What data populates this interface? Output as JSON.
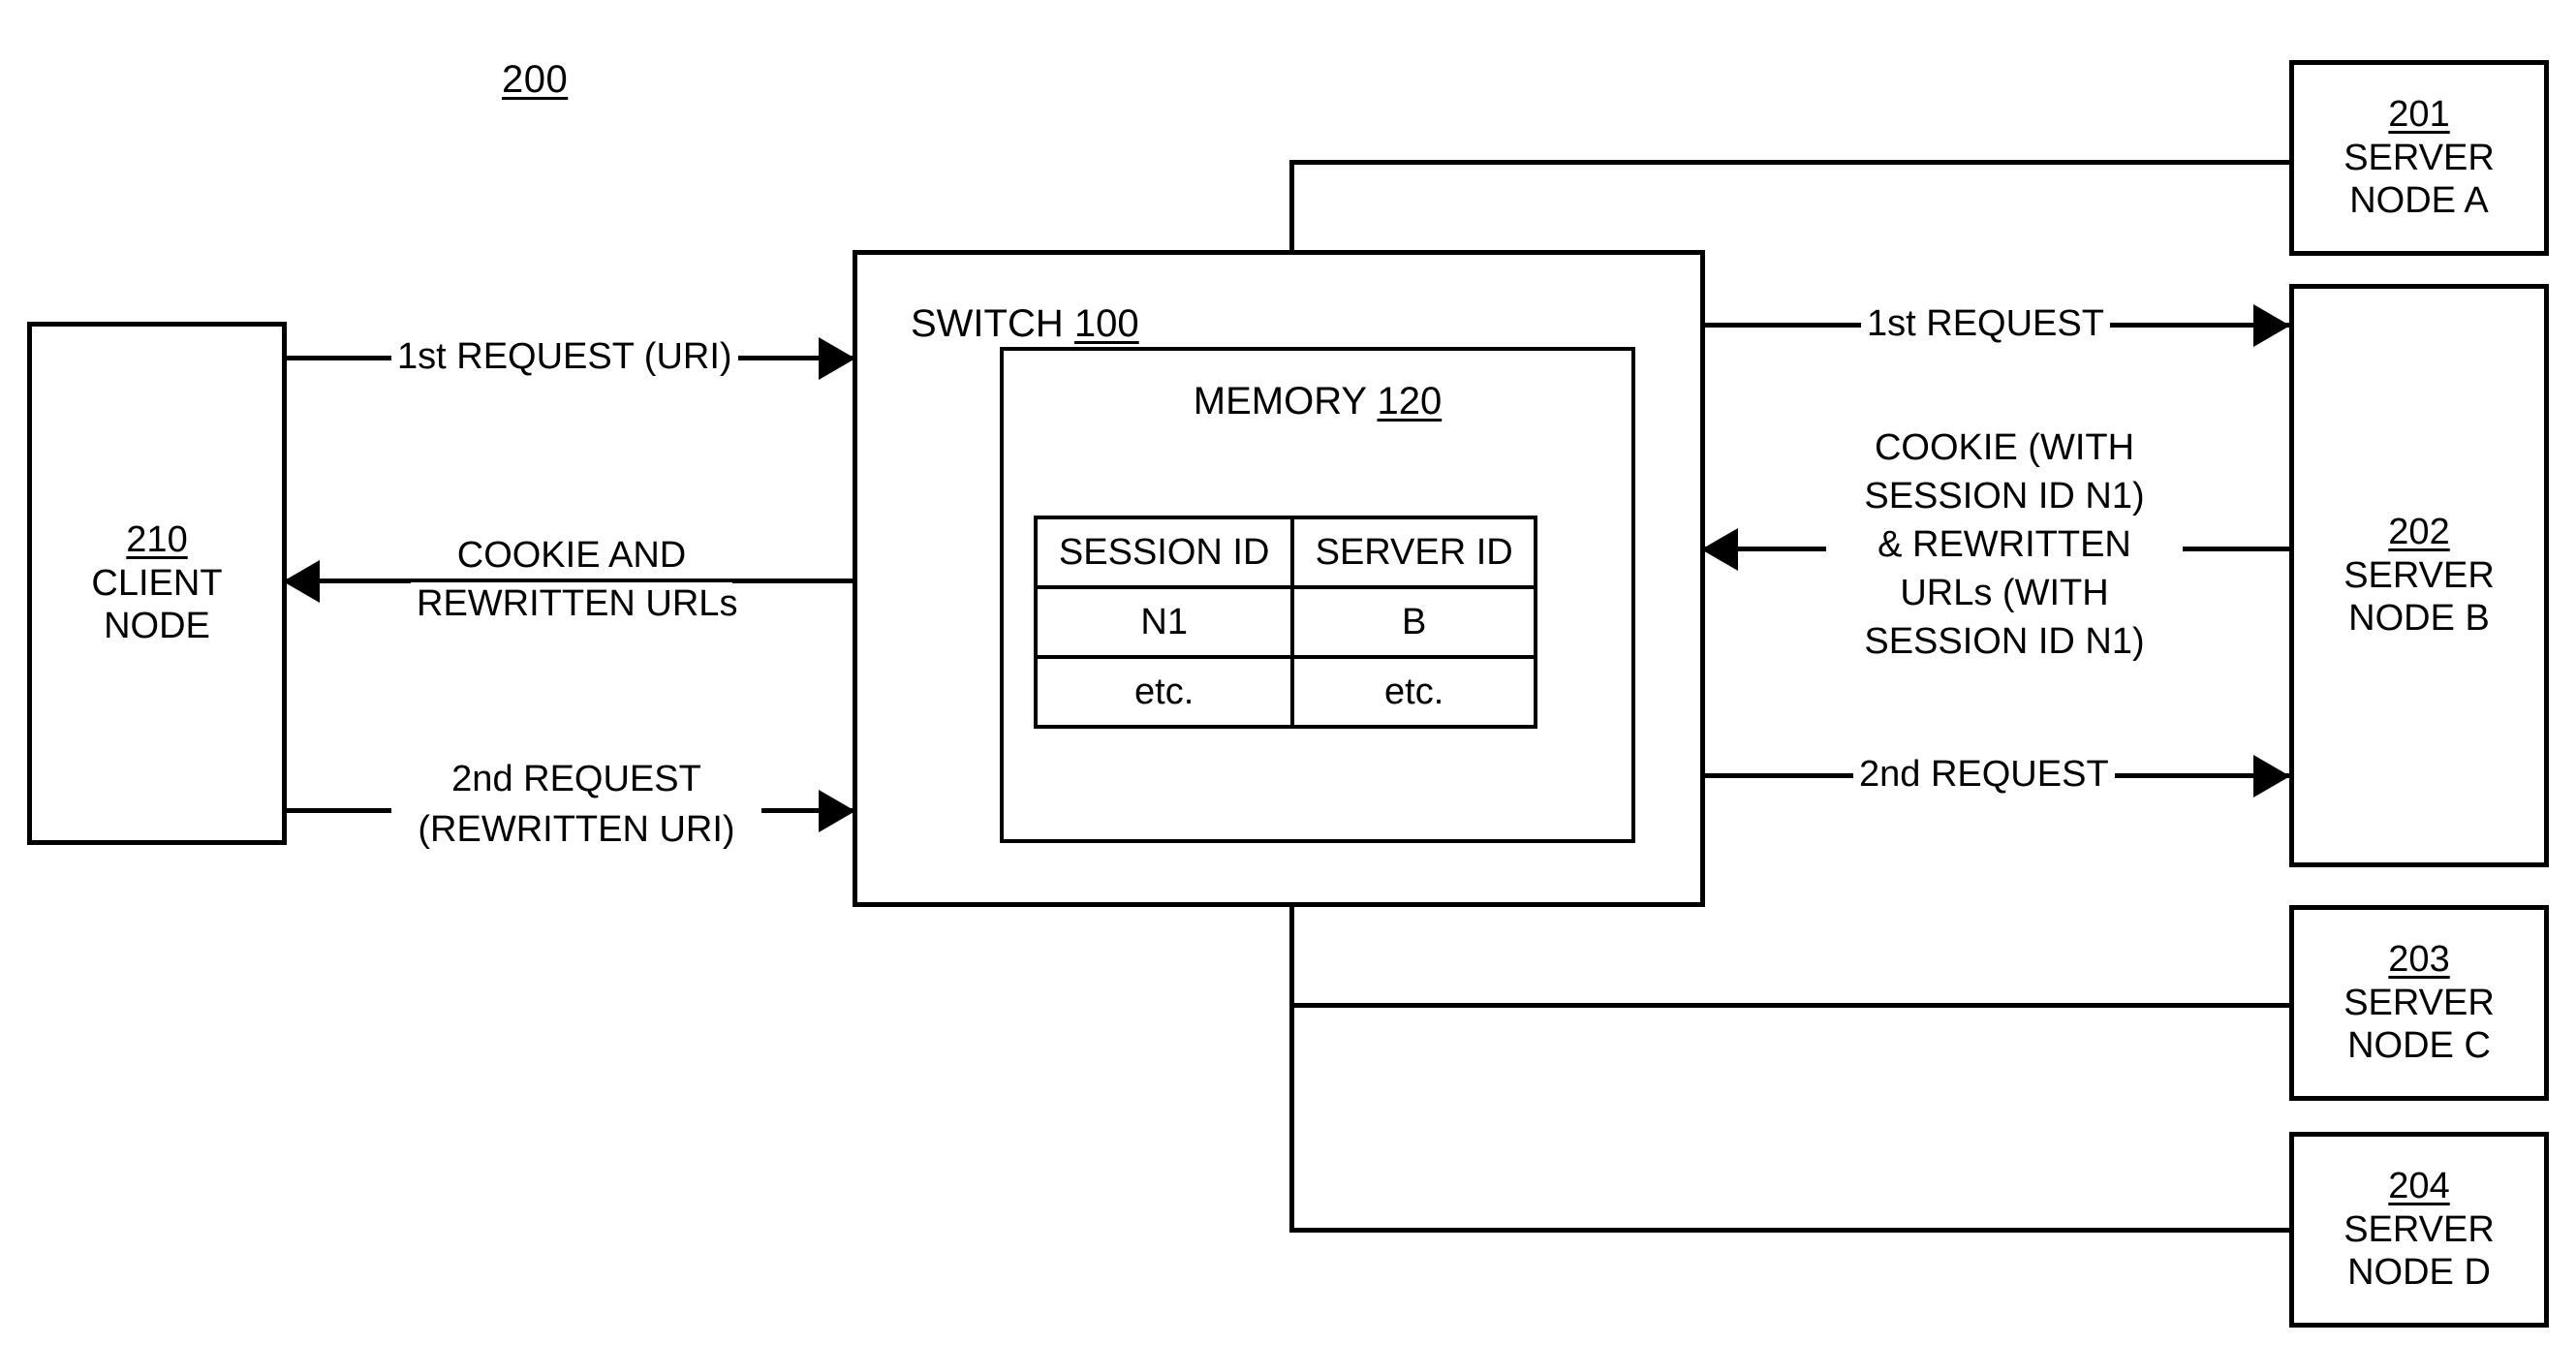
{
  "figure": {
    "number": "200"
  },
  "client": {
    "ref": "210",
    "line1": "CLIENT",
    "line2": "NODE"
  },
  "switch": {
    "label": "SWITCH",
    "ref": "100",
    "memory": {
      "label": "MEMORY",
      "ref": "120",
      "table": {
        "headers": [
          "SESSION ID",
          "SERVER ID"
        ],
        "rows": [
          [
            "N1",
            "B"
          ],
          [
            "etc.",
            "etc."
          ]
        ]
      }
    }
  },
  "servers": [
    {
      "ref": "201",
      "line1": "SERVER",
      "line2": "NODE A"
    },
    {
      "ref": "202",
      "line1": "SERVER",
      "line2": "NODE B"
    },
    {
      "ref": "203",
      "line1": "SERVER",
      "line2": "NODE C"
    },
    {
      "ref": "204",
      "line1": "SERVER",
      "line2": "NODE D"
    }
  ],
  "edges": {
    "client_to_switch_first": "1st REQUEST (URI)",
    "switch_to_client_cookie_l1": "COOKIE AND",
    "switch_to_client_cookie_l2": "REWRITTEN URLs",
    "client_to_switch_second_l1": "2nd REQUEST",
    "client_to_switch_second_l2": "(REWRITTEN URI)",
    "switch_to_b_first": "1st REQUEST",
    "b_to_switch_cookie_l1": "COOKIE (WITH",
    "b_to_switch_cookie_l2": "SESSION ID N1)",
    "b_to_switch_cookie_l3": "& REWRITTEN",
    "b_to_switch_cookie_l4": "URLs (WITH",
    "b_to_switch_cookie_l5": "SESSION ID N1)",
    "switch_to_b_second": "2nd REQUEST"
  },
  "colors": {
    "ink": "#000000",
    "paper": "#ffffff"
  }
}
